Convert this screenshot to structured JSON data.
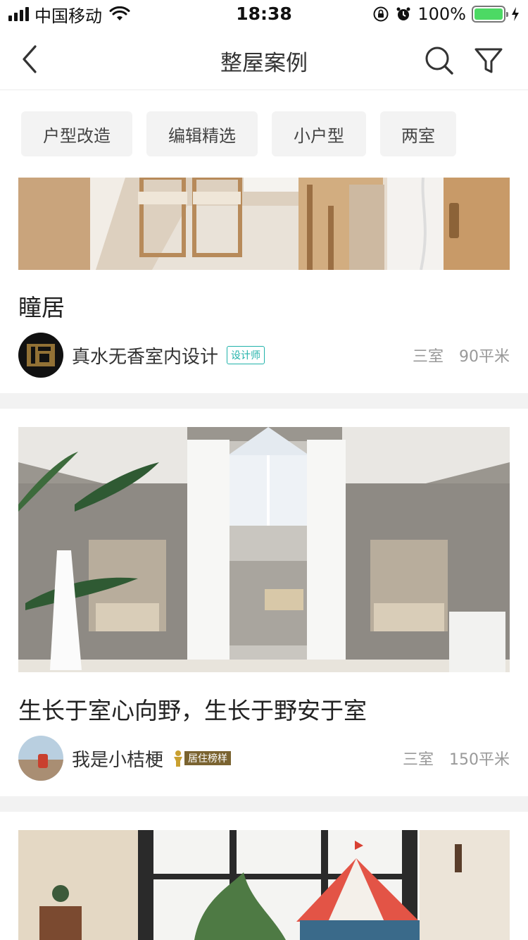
{
  "status_bar": {
    "carrier": "中国移动",
    "time": "18:38",
    "battery": "100%"
  },
  "nav": {
    "title": "整屋案例"
  },
  "chips": [
    "户型改造",
    "编辑精选",
    "小户型",
    "两室"
  ],
  "cards": [
    {
      "title": "瞳居",
      "author": "真水无香室内设计",
      "badge": "设计师",
      "rooms": "三室",
      "area": "90平米"
    },
    {
      "title": "生长于室心向野，生长于野安于室",
      "author": "我是小桔梗",
      "badge": "居住榜样",
      "rooms": "三室",
      "area": "150平米"
    }
  ]
}
